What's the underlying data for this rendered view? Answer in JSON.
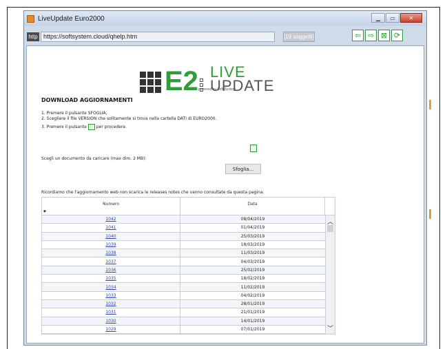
{
  "window": {
    "title": "LiveUpdate Euro2000",
    "minimize": "▁",
    "maximize": "▭",
    "close": "✕"
  },
  "address": {
    "protocol": "http",
    "url": "https://softsystem.cloud/qhelp.htm",
    "topics": "[19 soggetti]"
  },
  "nav": {
    "back_icon": "⇦",
    "forward_icon": "⇨",
    "stop_icon": "⊠",
    "refresh_icon": "⟳"
  },
  "logo": {
    "e2": "E2",
    "powered": "powered by Soft System",
    "live": "LIVE",
    "update": "UPDATE"
  },
  "page": {
    "heading": "DOWNLOAD AGGIORNAMENTI",
    "step1": "1. Premere il pulsante SFOGLIA;",
    "step2": "2. Scegliere il file VERSION che solitamente si trova nella cartella DATI di EURO2000.",
    "step3_pre": "3. Premere il pulsante",
    "step3_post": "per procedere.",
    "choose_label": "Scegli un documento da caricare (max dim. 2 MB):",
    "browse_label": "Sfoglia...",
    "note": "Ricordiamo che l'aggiornamento web non scarica le releases notes che vanno consultate da questa pagina:"
  },
  "table": {
    "headers": [
      "Numero",
      "Data"
    ],
    "sort_marker": "◆",
    "rows": [
      {
        "num": "1042",
        "date": "08/04/2019"
      },
      {
        "num": "1041",
        "date": "01/04/2019"
      },
      {
        "num": "1040",
        "date": "25/03/2019"
      },
      {
        "num": "1039",
        "date": "18/03/2019"
      },
      {
        "num": "1038",
        "date": "11/03/2019"
      },
      {
        "num": "1037",
        "date": "04/03/2019"
      },
      {
        "num": "1036",
        "date": "25/02/2019"
      },
      {
        "num": "1035",
        "date": "18/02/2019"
      },
      {
        "num": "1034",
        "date": "11/02/2019"
      },
      {
        "num": "1033",
        "date": "04/02/2019"
      },
      {
        "num": "1032",
        "date": "28/01/2019"
      },
      {
        "num": "1031",
        "date": "21/01/2019"
      },
      {
        "num": "1030",
        "date": "14/01/2019"
      },
      {
        "num": "1029",
        "date": "07/01/2019"
      }
    ],
    "scroll_up": "︿",
    "scroll_down": "﹀"
  }
}
